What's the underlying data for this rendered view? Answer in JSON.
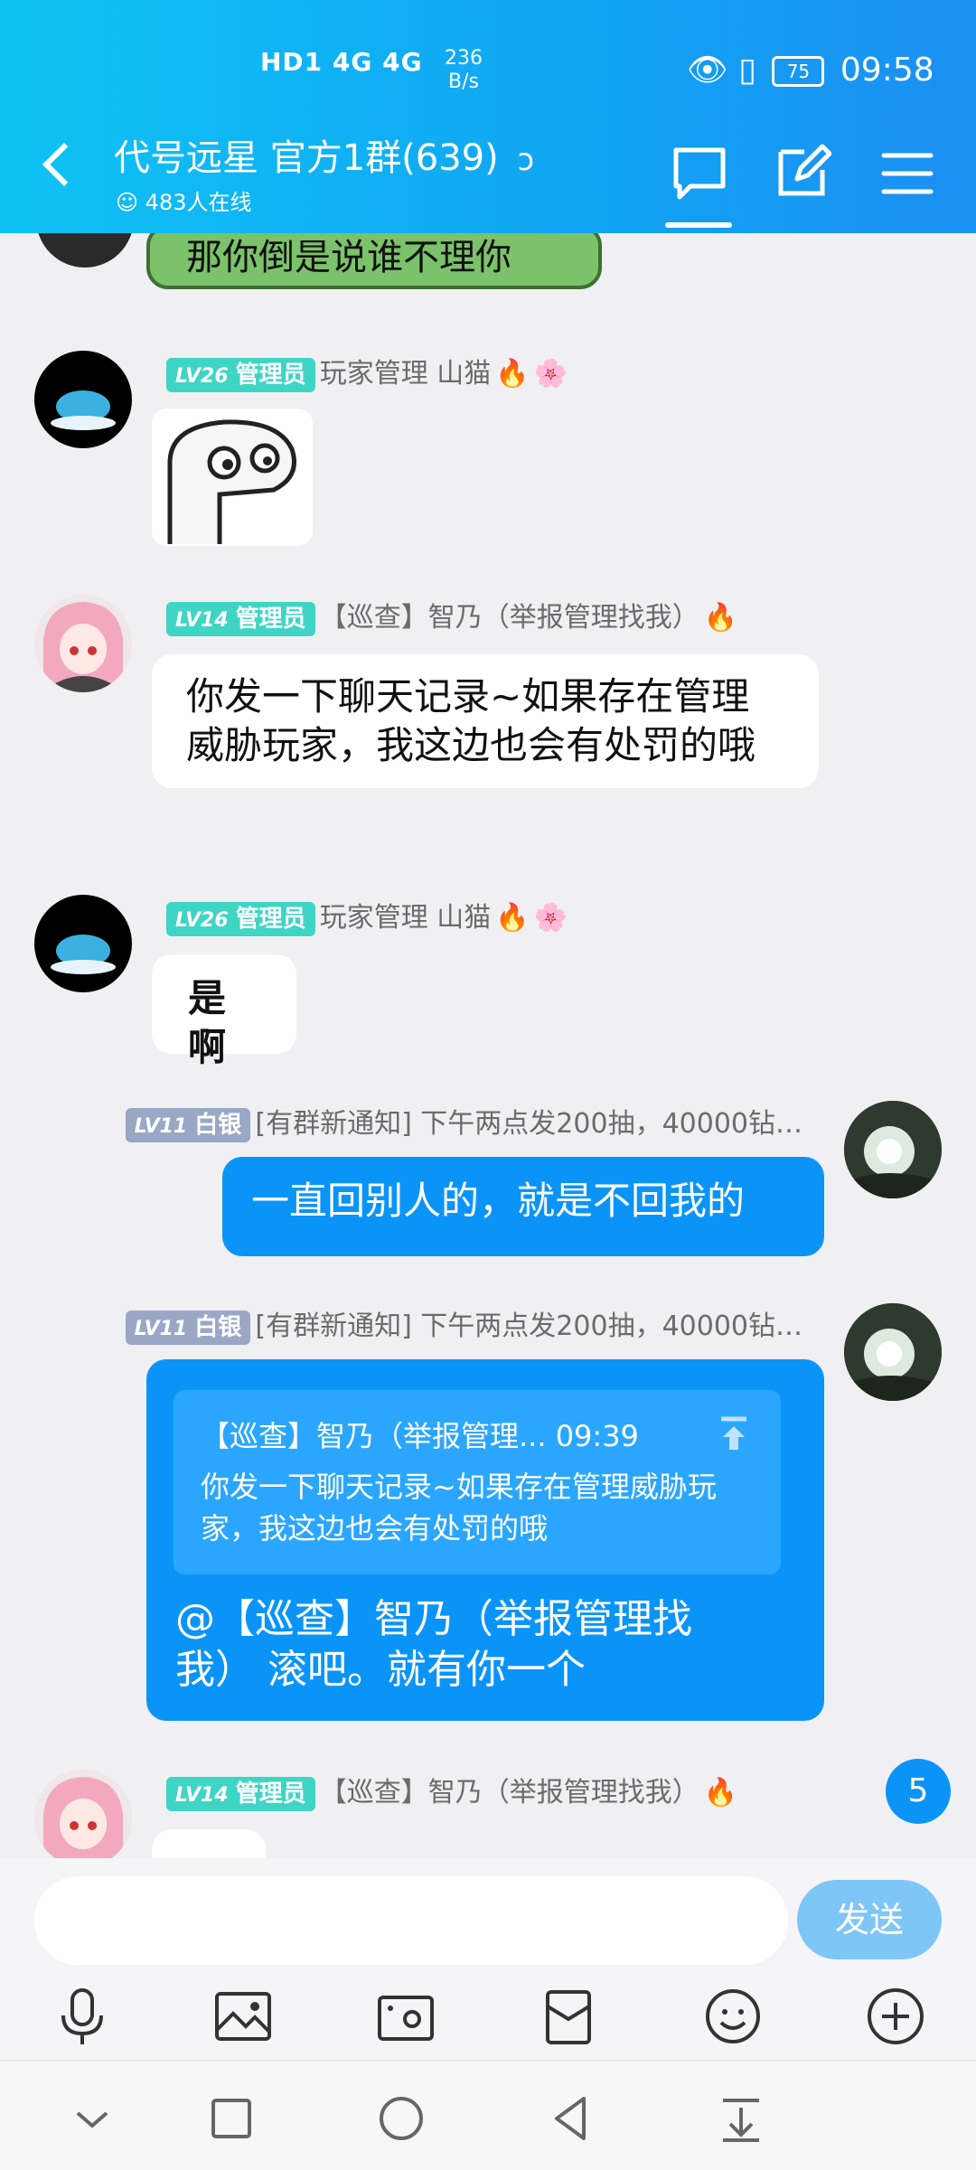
{
  "status_bar": {
    "network": "HD1 4G 4G",
    "speed_value": "236",
    "speed_unit": "B/s",
    "battery": "75",
    "time": "09:58"
  },
  "header": {
    "title": "代号远星 官方1群(639)",
    "online": "483人在线"
  },
  "messages": {
    "m0": {
      "text": "那你倒是说谁不理你"
    },
    "m1": {
      "lv": "LV26",
      "role": "管理员",
      "name": "玩家管理 山猫"
    },
    "m2": {
      "lv": "LV14",
      "role": "管理员",
      "name": "【巡查】智乃（举报管理找我）",
      "text": "你发一下聊天记录~如果存在管理威胁玩家，我这边也会有处罚的哦"
    },
    "m3": {
      "lv": "LV26",
      "role": "管理员",
      "name": "玩家管理 山猫",
      "text": "是啊"
    },
    "m4": {
      "lv": "LV11",
      "role": "白银",
      "name": "[有群新通知] 下午两点发200抽，40000钻…",
      "text": "一直回别人的，就是不回我的"
    },
    "m5": {
      "lv": "LV11",
      "role": "白银",
      "name": "[有群新通知] 下午两点发200抽，40000钻…",
      "quote_header": "【巡查】智乃（举报管理... 09:39",
      "quote_text": "你发一下聊天记录~如果存在管理威胁玩家，我这边也会有处罚的哦",
      "text": "@【巡查】智乃（举报管理找我） 滚吧。就有你一个"
    },
    "m6": {
      "lv": "LV14",
      "role": "管理员",
      "name": "【巡查】智乃（举报管理找我）"
    }
  },
  "unread_count": "5",
  "input": {
    "placeholder": "",
    "send_label": "发送"
  },
  "colors": {
    "header": "#11a4f3",
    "my_bubble": "#0b94f8",
    "admin_badge": "#3fd5c4",
    "silver_badge": "#9aa8c6"
  },
  "icons": [
    "back-arrow-icon",
    "ear-icon",
    "chat-icon",
    "edit-icon",
    "menu-icon",
    "mic-icon",
    "image-icon",
    "camera-icon",
    "red-packet-icon",
    "emoji-icon",
    "plus-icon",
    "fire-icon",
    "flower-icon"
  ]
}
